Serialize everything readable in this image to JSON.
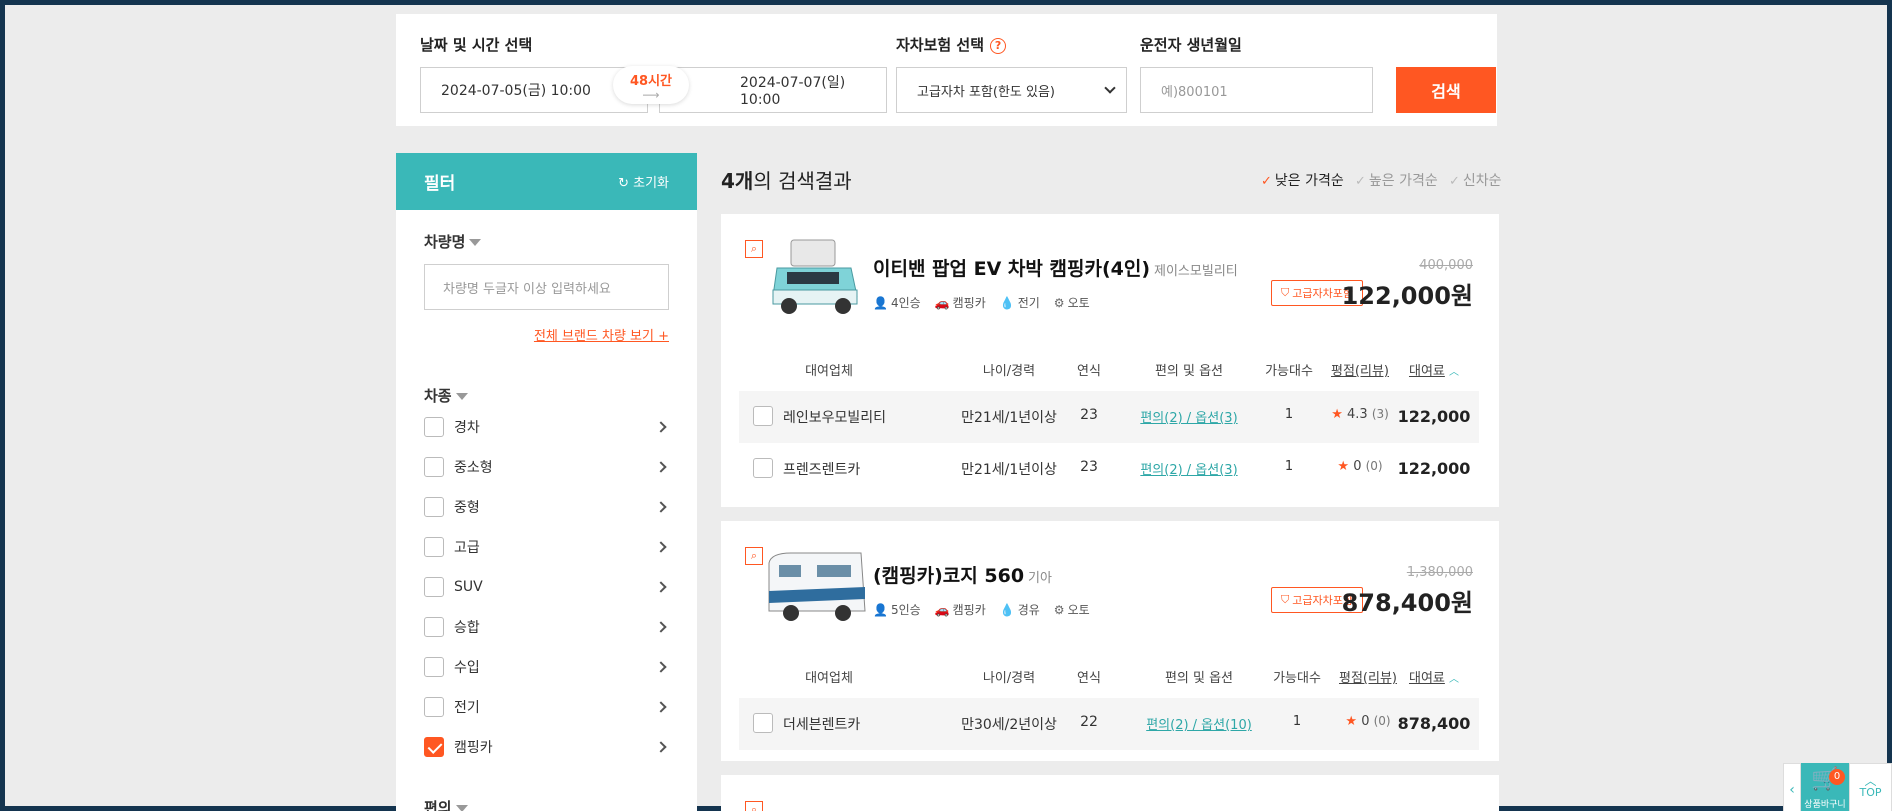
{
  "search": {
    "datetime_label": "날짜 및 시간 선택",
    "start_datetime": "2024-07-05(금) 10:00",
    "end_datetime": "2024-07-07(일) 10:00",
    "duration": "48시간",
    "insurance_label": "자차보험 선택",
    "insurance_value": "고급자차 포함(한도 있음)",
    "birth_label": "운전자 생년월일",
    "birth_placeholder": "예)800101",
    "search_button": "검색"
  },
  "filter": {
    "title": "필터",
    "reset": "초기화",
    "car_name_title": "차량명",
    "car_name_placeholder": "차량명 두글자 이상 입력하세요",
    "brand_link": "전체 브랜드 차량 보기 +",
    "car_type_title": "차종",
    "car_types": [
      {
        "label": "경차",
        "checked": false
      },
      {
        "label": "중소형",
        "checked": false
      },
      {
        "label": "중형",
        "checked": false
      },
      {
        "label": "고급",
        "checked": false
      },
      {
        "label": "SUV",
        "checked": false
      },
      {
        "label": "승합",
        "checked": false
      },
      {
        "label": "수입",
        "checked": false
      },
      {
        "label": "전기",
        "checked": false
      },
      {
        "label": "캠핑카",
        "checked": true
      }
    ],
    "next_section_title": "편의"
  },
  "results": {
    "count_bold": "4개",
    "count_rest": "의 검색결과",
    "sort_options": [
      "낮은 가격순",
      "높은 가격순",
      "신차순"
    ],
    "sort_active": "낮은 가격순",
    "table_headers": {
      "company": "대여업체",
      "age": "나이/경력",
      "year": "연식",
      "options": "편의 및 옵션",
      "available": "가능대수",
      "rating": "평점(리뷰)",
      "fee": "대여료"
    },
    "cars": [
      {
        "title": "이티밴 팝업 EV 차박 캠핑카(4인)",
        "maker": "제이스모빌리티",
        "seats": "4인승",
        "category": "캠핑카",
        "fuel": "전기",
        "transmission": "오토",
        "insurance_badge": "고급자차포함",
        "original_price": "400,000",
        "price": "122,000원",
        "rows": [
          {
            "company": "레인보우모빌리티",
            "age": "만21세/1년이상",
            "year": "23",
            "options": "편의(2) / 옵션(3)",
            "available": "1",
            "rating": "4.3",
            "reviews": "(3)",
            "fee": "122,000"
          },
          {
            "company": "프렌즈렌트카",
            "age": "만21세/1년이상",
            "year": "23",
            "options": "편의(2) / 옵션(3)",
            "available": "1",
            "rating": "0",
            "reviews": "(0)",
            "fee": "122,000"
          }
        ]
      },
      {
        "title": "(캠핑카)코지 560",
        "maker": "기아",
        "seats": "5인승",
        "category": "캠핑카",
        "fuel": "경유",
        "transmission": "오토",
        "insurance_badge": "고급자차포함",
        "original_price": "1,380,000",
        "price": "878,400원",
        "rows": [
          {
            "company": "더세븐렌트카",
            "age": "만30세/2년이상",
            "year": "22",
            "options": "편의(2) / 옵션(10)",
            "available": "1",
            "rating": "0",
            "reviews": "(0)",
            "fee": "878,400"
          }
        ]
      }
    ]
  },
  "cart": {
    "count": "0",
    "label": "상품바구니"
  },
  "top_button": "TOP",
  "colors": {
    "accent": "#ff5722",
    "teal": "#3ab8b8",
    "border": "#14344f"
  }
}
